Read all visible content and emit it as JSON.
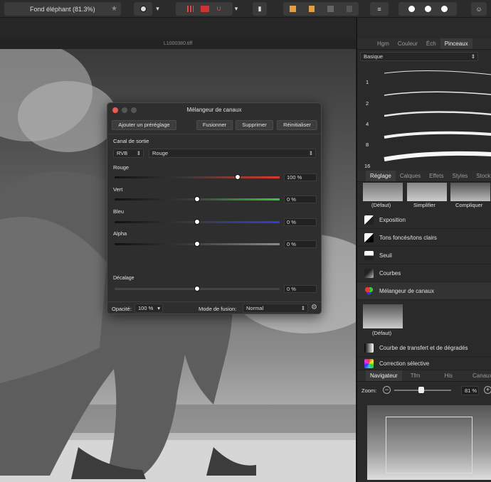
{
  "toolbar": {
    "document_name": "Fond éléphant (81.3%)"
  },
  "canvas": {
    "title": "L1000380.tiff"
  },
  "right_panel": {
    "top_tabs": [
      "Hgm",
      "Couleur",
      "Éch",
      "Pinceaux"
    ],
    "brush_category": "Basique",
    "brush_sizes": [
      "1",
      "2",
      "4",
      "8",
      "16"
    ],
    "adjust_tabs": [
      "Réglage",
      "Calques",
      "Effets",
      "Styles",
      "Stock"
    ],
    "presets": [
      "(Défaut)",
      "Simplifier",
      "Compliquer"
    ],
    "adjustments": [
      "Exposition",
      "Tons foncés/tons clairs",
      "Seuil",
      "Courbes",
      "Mélangeur de canaux"
    ],
    "selected_preset": "(Défaut)",
    "adjustments_after": [
      "Courbe de transfert et de dégradés",
      "Correction sélective"
    ],
    "nav_tabs": [
      "Navigateur",
      "Tfm",
      "His",
      "Canaux"
    ],
    "zoom_label": "Zoom:",
    "zoom_value": "81 %"
  },
  "dialog": {
    "title": "Mélangeur de canaux",
    "buttons": {
      "add_preset": "Ajouter un préréglage",
      "merge": "Fusionner",
      "delete": "Supprimer",
      "reset": "Réinitialiser"
    },
    "output_channel_label": "Canal de sortie",
    "colorspace": "RVB",
    "output_channel": "Rouge",
    "channels": [
      {
        "label": "Rouge",
        "value": "100 %",
        "level": 1.0,
        "color": "#d93a2b"
      },
      {
        "label": "Vert",
        "value": "0 %",
        "level": 0.0,
        "color": "#3ec63e"
      },
      {
        "label": "Bleu",
        "value": "0 %",
        "level": 0.0,
        "color": "#2f3fd8"
      },
      {
        "label": "Alpha",
        "value": "0 %",
        "level": 0.0,
        "color": "#8a8a8a"
      }
    ],
    "offset_label": "Décalage",
    "offset_value": "0 %",
    "opacity_label": "Opacité:",
    "opacity_value": "100 %",
    "blend_label": "Mode de fusion:",
    "blend_value": "Normal"
  }
}
